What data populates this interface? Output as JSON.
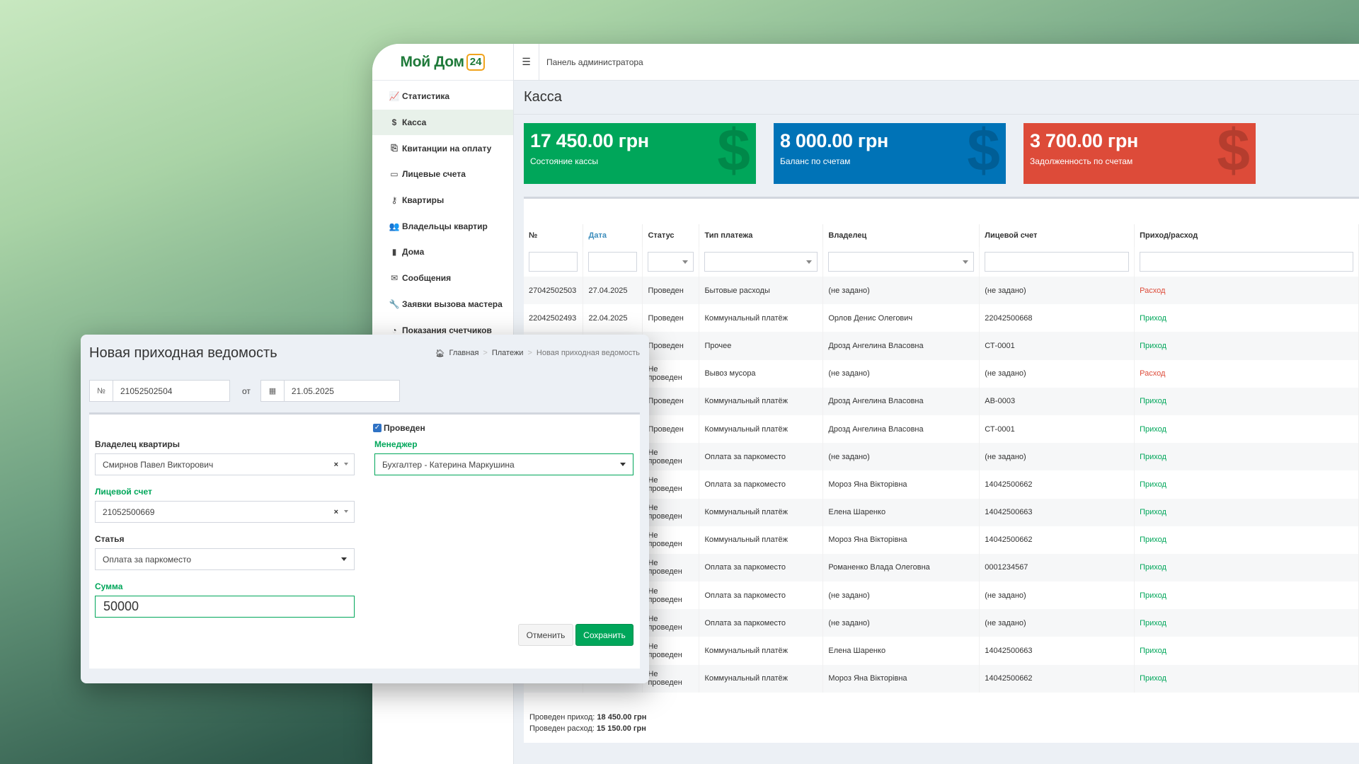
{
  "app": {
    "logo": {
      "text": "Мой Дом",
      "badge": "24"
    },
    "topbar": {
      "title": "Панель администратора"
    },
    "sidebar": {
      "items": [
        {
          "label": "Статистика",
          "icon": "chart-icon",
          "glyph": "📈"
        },
        {
          "label": "Касса",
          "icon": "dollar-icon",
          "glyph": "$"
        },
        {
          "label": "Квитанции на оплату",
          "icon": "receipt-icon",
          "glyph": "⎘"
        },
        {
          "label": "Лицевые счета",
          "icon": "card-icon",
          "glyph": "▭"
        },
        {
          "label": "Квартиры",
          "icon": "key-icon",
          "glyph": "⚷"
        },
        {
          "label": "Владельцы квартир",
          "icon": "users-icon",
          "glyph": "👥"
        },
        {
          "label": "Дома",
          "icon": "building-icon",
          "glyph": "▮"
        },
        {
          "label": "Сообщения",
          "icon": "envelope-icon",
          "glyph": "✉"
        },
        {
          "label": "Заявки вызова мастера",
          "icon": "wrench-icon",
          "glyph": "🔧"
        },
        {
          "label": "Показания счетчиков",
          "icon": "dashboard-icon",
          "glyph": "◔"
        }
      ]
    },
    "page_title": "Касса",
    "stats": [
      {
        "amount": "17 450.00 грн",
        "label": "Состояние кассы",
        "color": "#00a65a"
      },
      {
        "amount": "8 000.00 грн",
        "label": "Баланс по счетам",
        "color": "#0073b7"
      },
      {
        "amount": "3 700.00 грн",
        "label": "Задолженность по счетам",
        "color": "#dd4b39"
      }
    ],
    "table": {
      "columns": [
        "№",
        "Дата",
        "Статус",
        "Тип платежа",
        "Владелец",
        "Лицевой счет",
        "Приход/расход"
      ],
      "rows": [
        [
          "27042502503",
          "27.04.2025",
          "Проведен",
          "Бытовые расходы",
          "(не задано)",
          "(не задано)",
          "Расход"
        ],
        [
          "22042502493",
          "22.04.2025",
          "Проведен",
          "Коммунальный платёж",
          "Орлов Денис Олегович",
          "22042500668",
          "Приход"
        ],
        [
          "",
          "",
          "Проведен",
          "Прочее",
          "Дрозд Ангелина Власовна",
          "СТ-0001",
          "Приход"
        ],
        [
          "",
          "",
          "Не проведен",
          "Вывоз мусора",
          "(не задано)",
          "(не задано)",
          "Расход"
        ],
        [
          "",
          "",
          "Проведен",
          "Коммунальный платёж",
          "Дрозд Ангелина Власовна",
          "АВ-0003",
          "Приход"
        ],
        [
          "",
          "",
          "Проведен",
          "Коммунальный платёж",
          "Дрозд Ангелина Власовна",
          "СТ-0001",
          "Приход"
        ],
        [
          "",
          "",
          "Не проведен",
          "Оплата за паркоместо",
          "(не задано)",
          "(не задано)",
          "Приход"
        ],
        [
          "",
          "",
          "Не проведен",
          "Оплата за паркоместо",
          "Мороз Яна Вікторівна",
          "14042500662",
          "Приход"
        ],
        [
          "",
          "",
          "Не проведен",
          "Коммунальный платёж",
          "Елена Шаренко",
          "14042500663",
          "Приход"
        ],
        [
          "",
          "",
          "Не проведен",
          "Коммунальный платёж",
          "Мороз Яна Вікторівна",
          "14042500662",
          "Приход"
        ],
        [
          "",
          "",
          "Не проведен",
          "Оплата за паркоместо",
          "Романенко Влада Олеговна",
          "0001234567",
          "Приход"
        ],
        [
          "",
          "",
          "Не проведен",
          "Оплата за паркоместо",
          "(не задано)",
          "(не задано)",
          "Приход"
        ],
        [
          "",
          "",
          "Не проведен",
          "Оплата за паркоместо",
          "(не задано)",
          "(не задано)",
          "Приход"
        ],
        [
          "",
          "",
          "Не проведен",
          "Коммунальный платёж",
          "Елена Шаренко",
          "14042500663",
          "Приход"
        ],
        [
          "",
          "",
          "Не проведен",
          "Коммунальный платёж",
          "Мороз Яна Вікторівна",
          "14042500662",
          "Приход"
        ]
      ],
      "totals": {
        "income_label": "Проведен приход:",
        "income": "18 450.00 грн",
        "expense_label": "Проведен расход:",
        "expense": "15 150.00 грн"
      }
    }
  },
  "modal": {
    "title": "Новая приходная ведомость",
    "breadcrumb": [
      "Главная",
      "Платежи",
      "Новая приходная ведомость"
    ],
    "number_prefix": "№",
    "number": "21052502504",
    "from_label": "от",
    "date": "21.05.2025",
    "posted_label": "Проведен",
    "owner_label": "Владелец квартиры",
    "owner_value": "Смирнов Павел Викторович",
    "manager_label": "Менеджер",
    "manager_value": "Бухгалтер - Катерина Маркушина",
    "account_label": "Лицевой счет",
    "account_value": "21052500669",
    "article_label": "Статья",
    "article_value": "Оплата за паркоместо",
    "sum_label": "Сумма",
    "sum_value": "50000",
    "cancel_label": "Отменить",
    "save_label": "Сохранить"
  }
}
